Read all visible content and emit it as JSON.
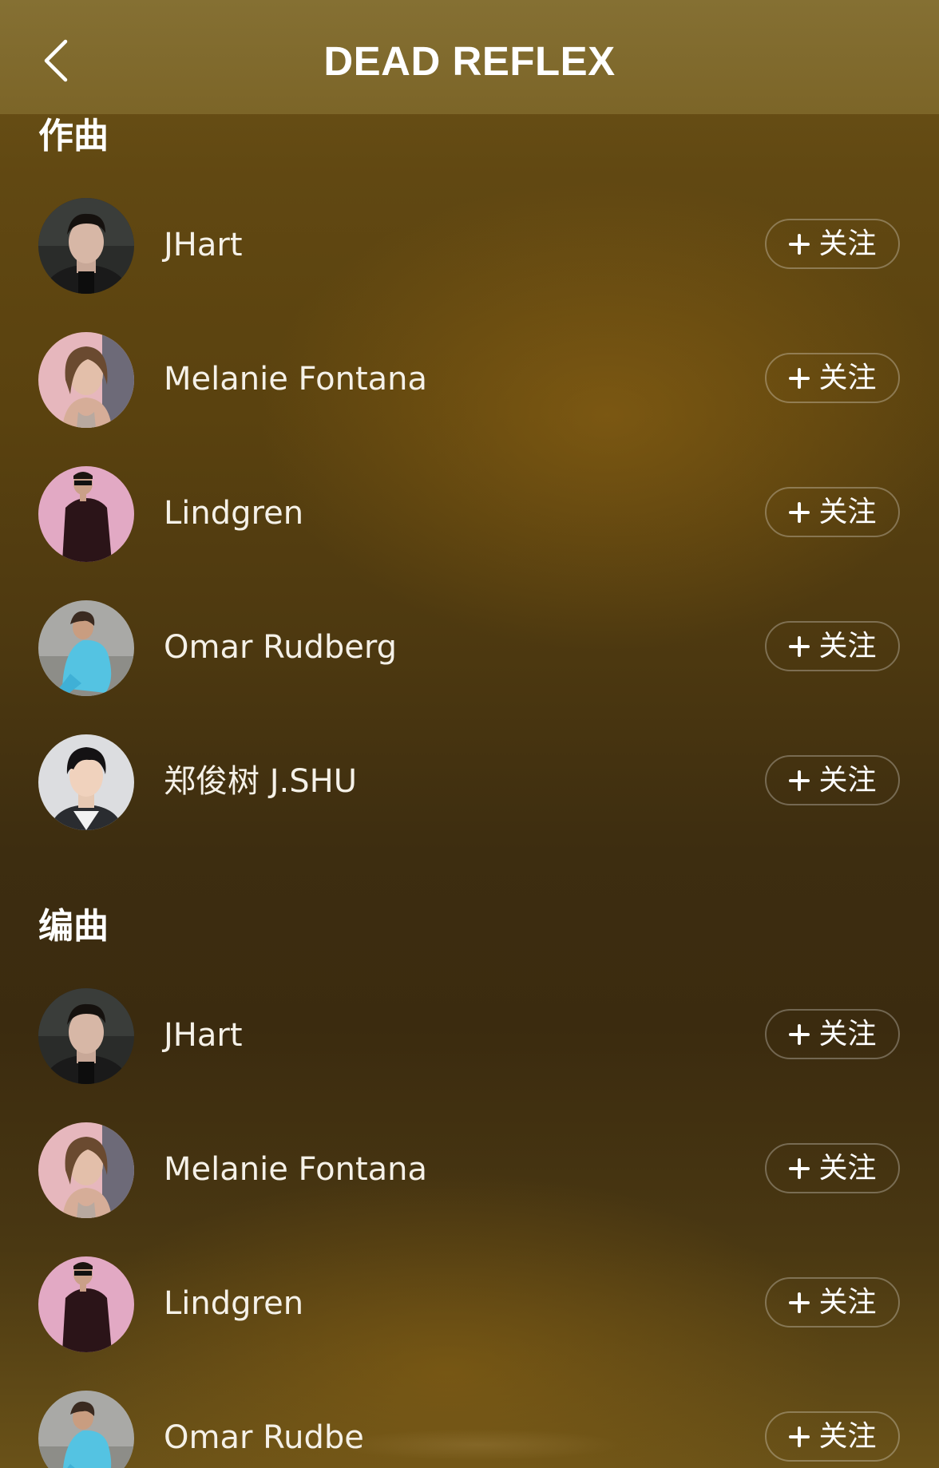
{
  "header": {
    "title": "DEAD REFLEX",
    "back_icon": "chevron-left-icon"
  },
  "sections": [
    {
      "title": "作曲",
      "people": [
        {
          "name": "JHart",
          "follow_label": "关注",
          "avatar": "man-dark-jacket"
        },
        {
          "name": "Melanie Fontana",
          "follow_label": "关注",
          "avatar": "woman-pink-bg"
        },
        {
          "name": "Lindgren",
          "follow_label": "关注",
          "avatar": "man-pink-bg"
        },
        {
          "name": "Omar Rudberg",
          "follow_label": "关注",
          "avatar": "person-blue-outfit"
        },
        {
          "name": "郑俊树 J.SHU",
          "follow_label": "关注",
          "avatar": "man-black-hair"
        }
      ]
    },
    {
      "title": "编曲",
      "people": [
        {
          "name": "JHart",
          "follow_label": "关注",
          "avatar": "man-dark-jacket"
        },
        {
          "name": "Melanie Fontana",
          "follow_label": "关注",
          "avatar": "woman-pink-bg"
        },
        {
          "name": "Lindgren",
          "follow_label": "关注",
          "avatar": "man-pink-bg"
        },
        {
          "name": "Omar Rudbe",
          "follow_label": "关注",
          "avatar": "person-blue-outfit"
        }
      ]
    }
  ],
  "colors": {
    "header_bg": "#857033",
    "text": "#ffffff",
    "button_border": "rgba(255,255,255,0.28)"
  }
}
